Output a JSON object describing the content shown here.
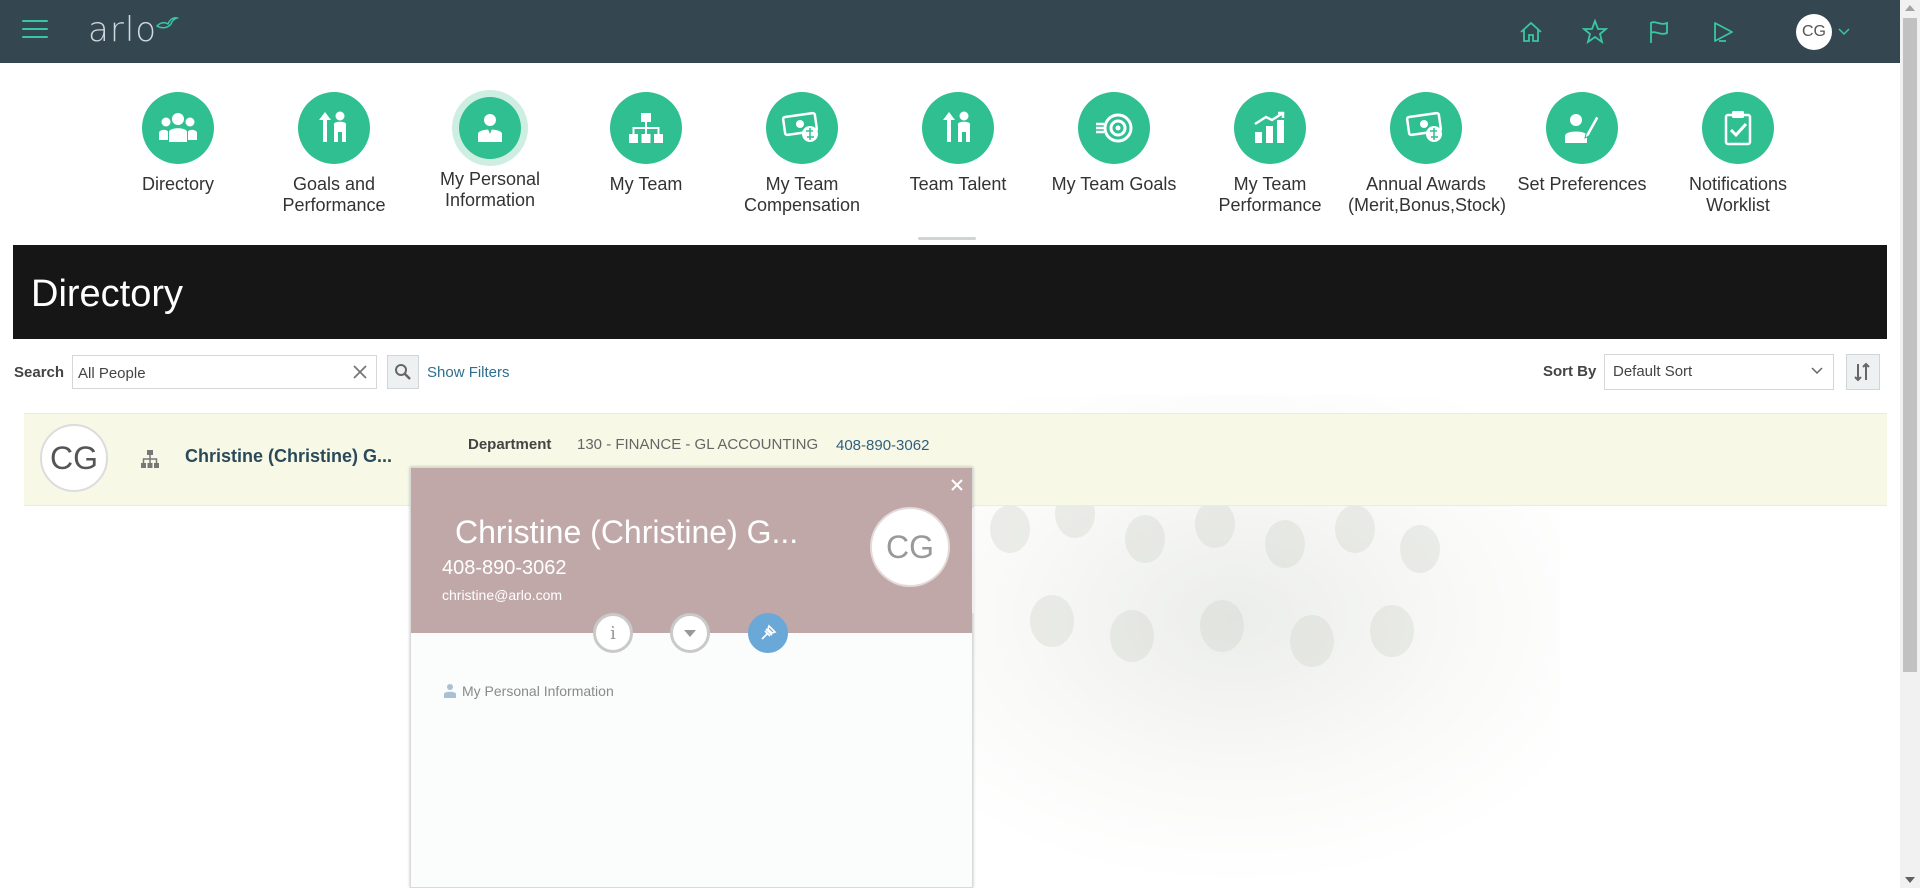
{
  "header": {
    "logo_text": "arlo",
    "user_initials": "CG",
    "icons": [
      "home-icon",
      "star-icon",
      "flag-icon",
      "bell-icon"
    ]
  },
  "tiles": [
    {
      "label": "Directory",
      "icon": "people-icon"
    },
    {
      "label": "Goals and Performance",
      "icon": "goals-icon"
    },
    {
      "label": "My Personal Information",
      "icon": "person-icon",
      "active": true
    },
    {
      "label": "My Team",
      "icon": "org-chart-icon"
    },
    {
      "label": "My Team Compensation",
      "icon": "money-icon"
    },
    {
      "label": "Team Talent",
      "icon": "talent-icon"
    },
    {
      "label": "My Team Goals",
      "icon": "target-icon"
    },
    {
      "label": "My Team Performance",
      "icon": "bar-chart-icon"
    },
    {
      "label": "Annual Awards (Merit,Bonus,Stock)",
      "icon": "awards-icon"
    },
    {
      "label": "Set Preferences",
      "icon": "preferences-icon"
    },
    {
      "label": "Notifications Worklist",
      "icon": "clipboard-icon"
    }
  ],
  "directory": {
    "title": "Directory",
    "search_label": "Search",
    "search_value": "All People",
    "show_filters": "Show Filters",
    "sort_label": "Sort By",
    "sort_value": "Default Sort"
  },
  "result": {
    "initials": "CG",
    "name": "Christine (Christine) G...",
    "department_label": "Department",
    "department_value": "130 - FINANCE - GL ACCOUNTING",
    "phone": "408-890-3062"
  },
  "popup": {
    "name": "Christine (Christine) G...",
    "phone": "408-890-3062",
    "email": "christine@arlo.com",
    "initials": "CG",
    "link": "My Personal Information"
  },
  "colors": {
    "topbar": "#34464f",
    "accent": "#2fbf90",
    "popup_header": "#c1a8a8",
    "result_row": "#f7f8e6"
  }
}
